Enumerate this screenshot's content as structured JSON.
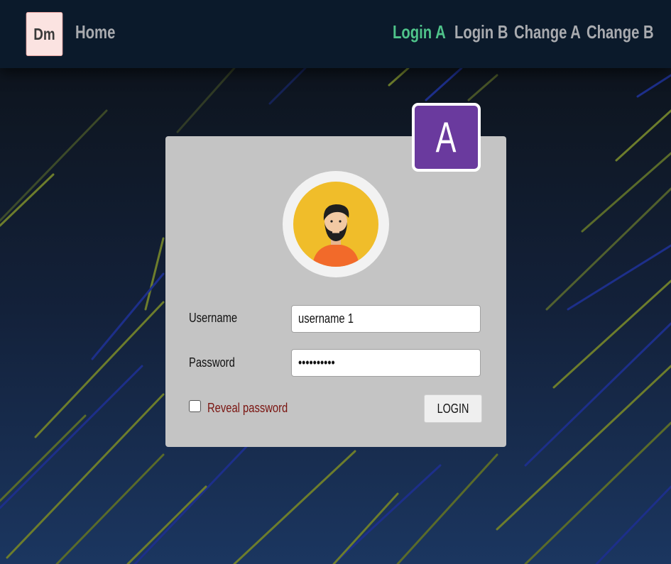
{
  "navbar": {
    "brand": "Dm",
    "home": "Home",
    "links": [
      {
        "label": "Login A",
        "active": true
      },
      {
        "label": "Login B",
        "active": false
      },
      {
        "label": "Change A",
        "active": false
      },
      {
        "label": "Change B",
        "active": false
      }
    ]
  },
  "card": {
    "badge": "A",
    "username_label": "Username",
    "username_value": "username 1",
    "password_label": "Password",
    "password_value": "••••••••••",
    "reveal_label": "Reveal password",
    "reveal_checked": false,
    "login_button": "LOGIN"
  },
  "colors": {
    "accent_active_link": "#4fc38a",
    "badge_bg": "#6a3a9e",
    "card_bg": "#c4c4c4",
    "reveal_label": "#7a1410"
  },
  "icons": {
    "avatar": "user-avatar-icon"
  }
}
